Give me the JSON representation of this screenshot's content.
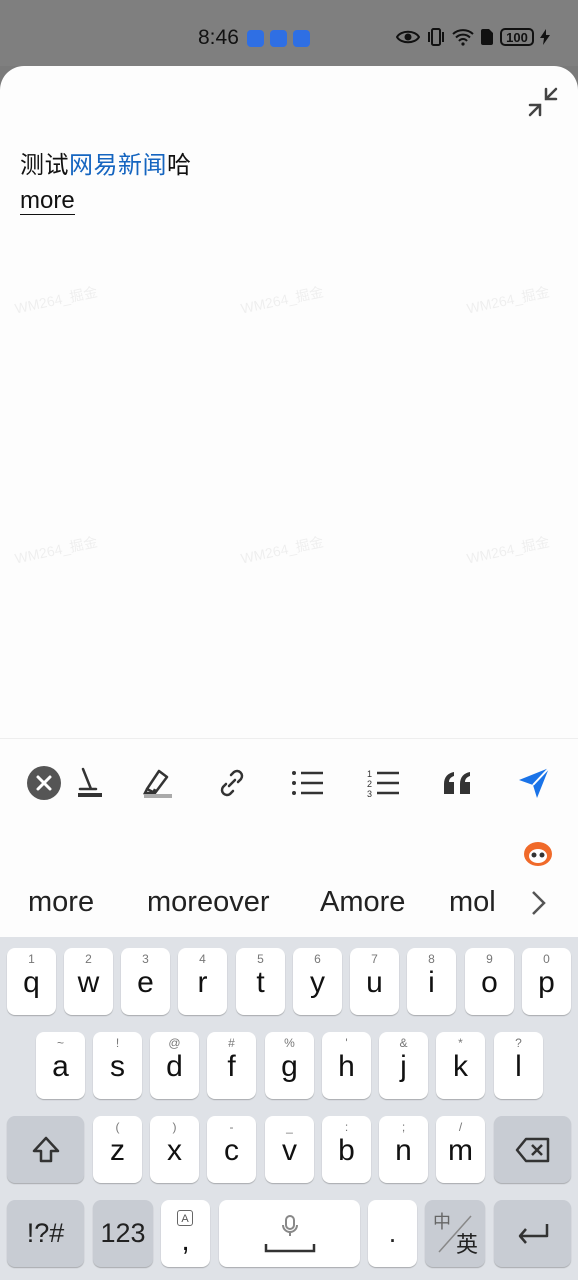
{
  "status_bar": {
    "time": "8:46",
    "battery": "100"
  },
  "editor": {
    "text_before": "测试",
    "link_text": "网易新闻",
    "text_after": "哈",
    "line2": "more"
  },
  "suggestions": [
    "more",
    "moreover",
    "Amore",
    "mol"
  ],
  "keyboard": {
    "row1": [
      {
        "ch": "q",
        "hint": "1"
      },
      {
        "ch": "w",
        "hint": "2"
      },
      {
        "ch": "e",
        "hint": "3"
      },
      {
        "ch": "r",
        "hint": "4"
      },
      {
        "ch": "t",
        "hint": "5"
      },
      {
        "ch": "y",
        "hint": "6"
      },
      {
        "ch": "u",
        "hint": "7"
      },
      {
        "ch": "i",
        "hint": "8"
      },
      {
        "ch": "o",
        "hint": "9"
      },
      {
        "ch": "p",
        "hint": "0"
      }
    ],
    "row2": [
      {
        "ch": "a",
        "hint": "~"
      },
      {
        "ch": "s",
        "hint": "!"
      },
      {
        "ch": "d",
        "hint": "@"
      },
      {
        "ch": "f",
        "hint": "#"
      },
      {
        "ch": "g",
        "hint": "%"
      },
      {
        "ch": "h",
        "hint": "'"
      },
      {
        "ch": "j",
        "hint": "&"
      },
      {
        "ch": "k",
        "hint": "*"
      },
      {
        "ch": "l",
        "hint": "?"
      }
    ],
    "row3": [
      {
        "ch": "z",
        "hint": "("
      },
      {
        "ch": "x",
        "hint": ")"
      },
      {
        "ch": "c",
        "hint": "-"
      },
      {
        "ch": "v",
        "hint": "_"
      },
      {
        "ch": "b",
        "hint": ":"
      },
      {
        "ch": "n",
        "hint": ";"
      },
      {
        "ch": "m",
        "hint": "/"
      }
    ],
    "symbols_key": "!?#",
    "numbers_key": "123",
    "comma_key": ",",
    "period_key": ".",
    "lang_key_top": "中",
    "lang_key_bottom": "英"
  },
  "watermark_text": "WM264_掘金",
  "colors": {
    "link": "#1565c0",
    "send": "#1a73e8",
    "keyboard_bg": "#dfe2e7"
  }
}
